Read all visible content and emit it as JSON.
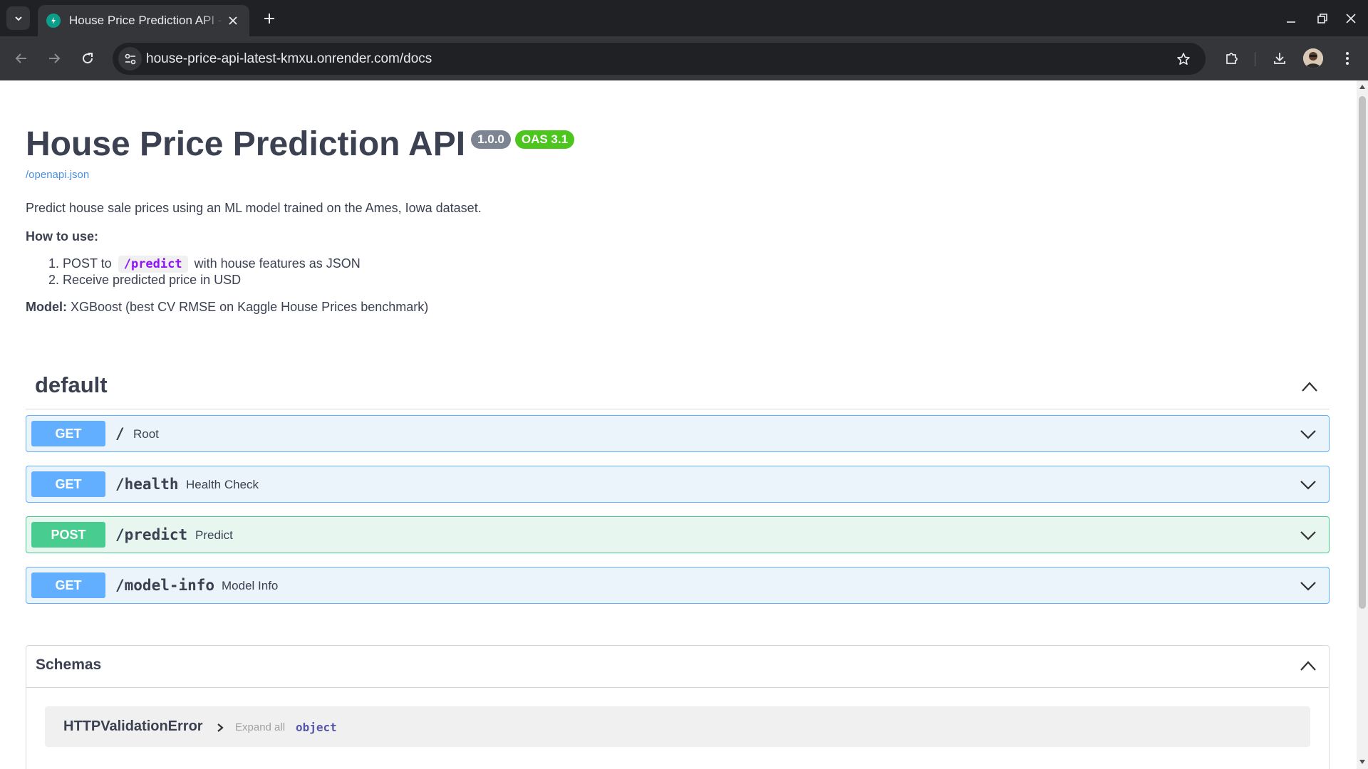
{
  "browser": {
    "tab_title": "House Price Prediction API - Swagger UI",
    "url": "house-price-api-latest-kmxu.onrender.com/docs"
  },
  "page": {
    "title": "House Price Prediction API",
    "version_badge": "1.0.0",
    "oas_badge": "OAS 3.1",
    "spec_link": "/openapi.json",
    "description": "Predict house sale prices using an ML model trained on the Ames, Iowa dataset.",
    "how_to_label": "How to use:",
    "steps": {
      "step1_prefix": "POST to",
      "step1_code": "/predict",
      "step1_suffix": "with house features as JSON",
      "step2": "Receive predicted price in USD"
    },
    "model_label": "Model:",
    "model_text": "XGBoost (best CV RMSE on Kaggle House Prices benchmark)"
  },
  "tag": {
    "name": "default"
  },
  "operations": [
    {
      "method": "GET",
      "path": "/",
      "summary": "Root"
    },
    {
      "method": "GET",
      "path": "/health",
      "summary": "Health Check"
    },
    {
      "method": "POST",
      "path": "/predict",
      "summary": "Predict"
    },
    {
      "method": "GET",
      "path": "/model-info",
      "summary": "Model Info"
    }
  ],
  "schemas": {
    "title": "Schemas",
    "model_name": "HTTPValidationError",
    "expand_all": "Expand all",
    "model_type": "object"
  },
  "colors": {
    "get": "#61affe",
    "post": "#49cc90",
    "version_badge": "#7d8492",
    "oas_badge": "#4cc51d",
    "code": "#9012fe"
  }
}
